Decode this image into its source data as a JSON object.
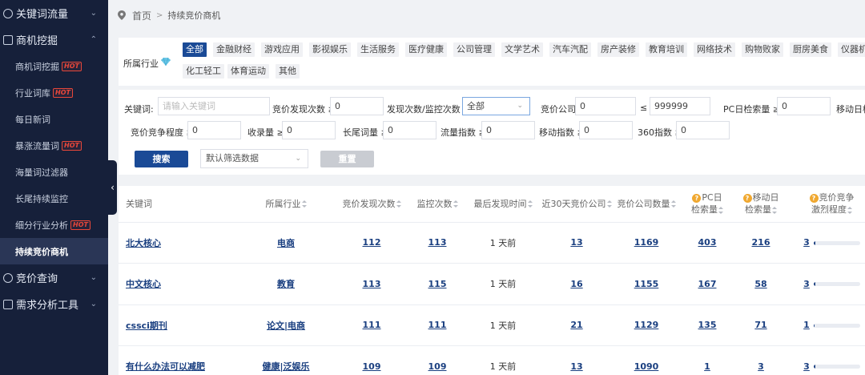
{
  "sidebar": {
    "menus": [
      {
        "label": "关键词流量",
        "icon": "keyword-icon"
      },
      {
        "label": "商机挖掘",
        "icon": "opportunity-icon"
      }
    ],
    "sub_items": [
      {
        "label": "商机词挖掘",
        "hot": "HOT"
      },
      {
        "label": "行业词库",
        "hot": "HOT"
      },
      {
        "label": "每日新词",
        "hot": ""
      },
      {
        "label": "暴涨流量词",
        "hot": "HOT"
      },
      {
        "label": "海量词过滤器",
        "hot": ""
      },
      {
        "label": "长尾持续监控",
        "hot": ""
      },
      {
        "label": "细分行业分析",
        "hot": "HOT"
      },
      {
        "label": "持续竞价商机",
        "hot": ""
      }
    ],
    "bottom_menus": [
      {
        "label": "竞价查询",
        "icon": "bid-query-icon"
      },
      {
        "label": "需求分析工具",
        "icon": "demand-analysis-icon"
      }
    ]
  },
  "breadcrumb": {
    "home": "首页",
    "sep": ">",
    "current": "持续竞价商机"
  },
  "industry": {
    "label": "所属行业",
    "tags": [
      "全部",
      "金融财经",
      "游戏应用",
      "影视娱乐",
      "生活服务",
      "医疗健康",
      "公司管理",
      "文学艺术",
      "汽车汽配",
      "房产装修",
      "教育培训",
      "网络技术",
      "购物败家",
      "厨房美食",
      "仪器机械",
      "化工轻工",
      "体育运动",
      "其他"
    ],
    "selected": "全部"
  },
  "filters": {
    "keyword_label": "关键词:",
    "keyword_placeholder": "请输入关键词",
    "bid_found_label": "竞价发现次数 ≥",
    "bid_found_value": "0",
    "ratio_label": "发现次数/监控次数 ≥",
    "ratio_value": "全部",
    "bid_company_label": "竞价公司",
    "bid_company_min": "0",
    "le_label": "≤",
    "bid_company_max": "999999",
    "pc_label": "PC日检索量 ≥",
    "pc_value": "0",
    "mobile_label": "移动日检",
    "competition_label": "竞价竞争程度 ≥",
    "competition_value": "0",
    "index_label": "收录量 ≥",
    "index_value": "0",
    "longtail_label": "长尾词量 ≥",
    "longtail_value": "0",
    "flow_label": "流量指数 ≥",
    "flow_value": "0",
    "mobile_index_label": "移动指数 ≥",
    "mobile_index_value": "0",
    "index360_label": "360指数 ≥",
    "index360_value": "0"
  },
  "actions": {
    "search": "搜索",
    "preset": "默认筛选数据",
    "reset": "重置"
  },
  "table": {
    "headers": [
      "关键词",
      "所属行业",
      "竞价发现次数",
      "监控次数",
      "最后发现时间",
      "近30天竞价公司",
      "竞价公司数量",
      "PC日\n检索量",
      "移动日\n检索量",
      "竞价竞争\n激烈程度"
    ],
    "rows": [
      {
        "keyword": "北大核心",
        "industry": "电商",
        "found": "112",
        "monitor": "113",
        "last": "1 天前",
        "recent30": "13",
        "companies": "1169",
        "pc": "403",
        "mobile": "216",
        "competition": "3",
        "bar": 0.04
      },
      {
        "keyword": "中文核心",
        "industry": "教育",
        "found": "113",
        "monitor": "115",
        "last": "1 天前",
        "recent30": "16",
        "companies": "1155",
        "pc": "167",
        "mobile": "58",
        "competition": "3",
        "bar": 0.04
      },
      {
        "keyword": "cssci期刊",
        "industry": "论文|电商",
        "found": "111",
        "monitor": "111",
        "last": "1 天前",
        "recent30": "21",
        "companies": "1129",
        "pc": "135",
        "mobile": "71",
        "competition": "1",
        "bar": 0.02
      },
      {
        "keyword": "有什么办法可以减肥",
        "industry": "健康|泛娱乐",
        "found": "109",
        "monitor": "109",
        "last": "1 天前",
        "recent30": "13",
        "companies": "1090",
        "pc": "1",
        "mobile": "3",
        "competition": "3",
        "bar": 0.04
      }
    ]
  },
  "colors": {
    "sidebar_bg": "#16203a",
    "primary": "#1a4a96",
    "hot": "#e8473a",
    "link": "#1a3f80",
    "help": "#f0a830"
  }
}
